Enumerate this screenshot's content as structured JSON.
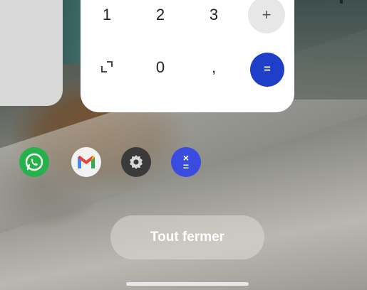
{
  "calculator": {
    "keys": {
      "one": "1",
      "two": "2",
      "three": "3",
      "plus": "+",
      "zero": "0",
      "comma": ",",
      "equals": "="
    }
  },
  "recents": {
    "apps": [
      {
        "name": "whatsapp-icon"
      },
      {
        "name": "gmail-icon"
      },
      {
        "name": "settings-icon"
      },
      {
        "name": "calculator-icon"
      }
    ],
    "calculator_icon": {
      "top": "×",
      "bottom": "="
    },
    "close_all_label": "Tout fermer"
  },
  "colors": {
    "equals_button": "#1f3fc8",
    "whatsapp": "#26b14a",
    "calculator_app": "#3a4be0"
  }
}
